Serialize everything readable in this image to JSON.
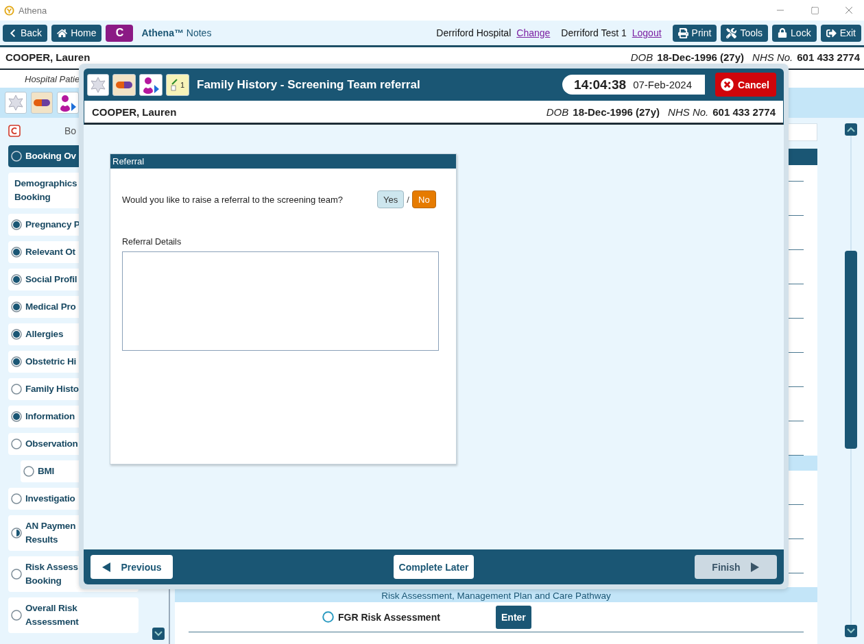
{
  "window": {
    "title": "Athena"
  },
  "toolbar": {
    "nav_buttons": [
      {
        "label": "Back",
        "kind": "back"
      },
      {
        "label": "Home",
        "kind": "home"
      }
    ],
    "app_button": "C",
    "app_name": "**Athena™** Notes",
    "location": "Derriford Hospital",
    "location_link": "Change",
    "user": "Derriford Test 1",
    "user_link": "Logout",
    "action_buttons": [
      {
        "label": "Print",
        "kind": "print"
      },
      {
        "label": "Tools",
        "kind": "tools"
      },
      {
        "label": "Lock",
        "kind": "lock"
      },
      {
        "label": "Exit",
        "kind": "exit"
      }
    ]
  },
  "patient": {
    "name": "COOPER, Lauren",
    "dob_label": "DOB",
    "dob": "18-Dec-1996 (27y)",
    "nhs_label": "NHS No.",
    "nhs": "601 433 2774"
  },
  "context_label": "Hospital Patie",
  "sidebar": {
    "header": "Bo",
    "items": [
      {
        "lines": [
          "Booking Ov"
        ],
        "kind": "todo",
        "selected": true
      },
      {
        "lines": [
          "Demographics",
          "Booking"
        ],
        "kind": "none",
        "selected": false
      },
      {
        "lines": [
          "Pregnancy P"
        ],
        "kind": "done",
        "selected": false
      },
      {
        "lines": [
          "Relevant Ot"
        ],
        "kind": "done",
        "selected": false
      },
      {
        "lines": [
          "Social Profil"
        ],
        "kind": "done",
        "selected": false
      },
      {
        "lines": [
          "Medical Pro"
        ],
        "kind": "done",
        "selected": false
      },
      {
        "lines": [
          "Allergies"
        ],
        "kind": "done",
        "selected": false
      },
      {
        "lines": [
          "Obstetric Hi"
        ],
        "kind": "done",
        "selected": false
      },
      {
        "lines": [
          "Family Histo"
        ],
        "kind": "todo",
        "selected": false
      },
      {
        "lines": [
          "Information"
        ],
        "kind": "done",
        "selected": false
      },
      {
        "lines": [
          "Observation"
        ],
        "kind": "todo",
        "selected": false,
        "children": [
          {
            "lines": [
              "BMI"
            ],
            "kind": "todo",
            "selected": false
          }
        ]
      },
      {
        "lines": [
          "Investigatio"
        ],
        "kind": "todo",
        "selected": false
      },
      {
        "lines": [
          "AN Paymen",
          "Results"
        ],
        "kind": "partial",
        "selected": false
      },
      {
        "lines": [
          "Risk Assess",
          "Booking"
        ],
        "kind": "todo",
        "selected": false
      },
      {
        "lines": [
          "Overall Risk",
          "Assessment"
        ],
        "kind": "todo",
        "selected": false
      }
    ]
  },
  "main": {
    "section_title": "Risk Assessment, Management Plan and Care Pathway",
    "rows": [
      {
        "label": "FGR Risk Assessment",
        "kind": "todo",
        "action": "Enter"
      }
    ]
  },
  "dialog": {
    "title": "Family History - Screening Team referral",
    "notes_count": "1",
    "time": "14:04:38",
    "date": "07-Feb-2024",
    "cancel": "Cancel",
    "patient": {
      "name": "COOPER, Lauren",
      "dob_label": "DOB",
      "dob": "18-Dec-1996 (27y)",
      "nhs_label": "NHS No.",
      "nhs": "601 433 2774"
    },
    "panel": {
      "title": "Referral",
      "question": "Would you like to raise a referral to the screening team?",
      "options": [
        {
          "label": "Yes",
          "selected": false
        },
        {
          "label": "No",
          "selected": true
        }
      ],
      "separator": "/",
      "details_label": "Referral Details"
    },
    "footer": {
      "buttons": [
        {
          "label": "Previous",
          "kind": "previous",
          "disabled": false
        },
        {
          "label": "Complete Later",
          "kind": "plain",
          "disabled": false
        },
        {
          "label": "Finish",
          "kind": "next",
          "disabled": true
        }
      ]
    }
  }
}
